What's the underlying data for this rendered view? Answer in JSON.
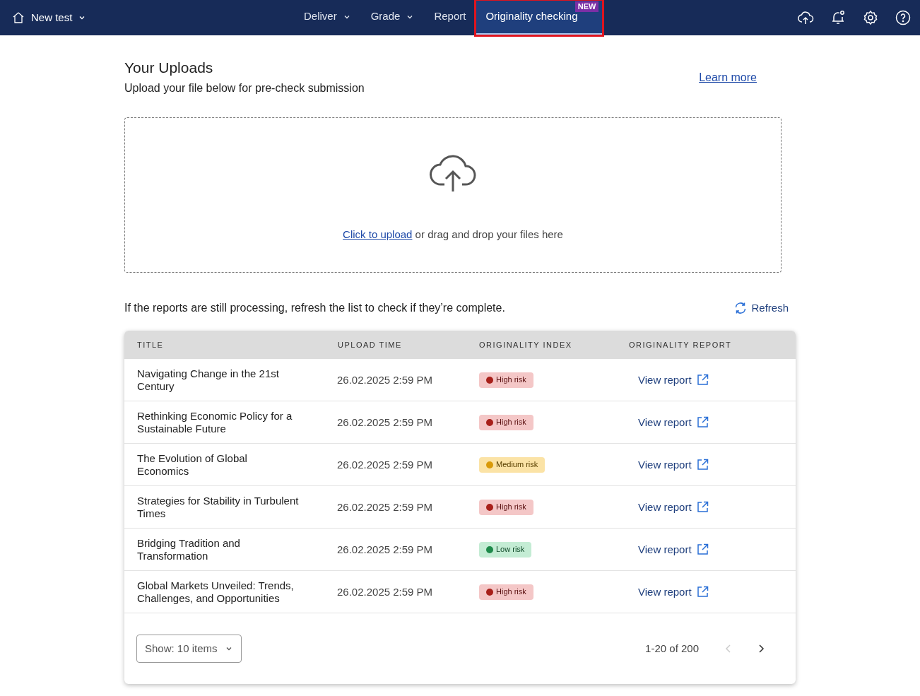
{
  "topbar": {
    "course": "New test",
    "nav": [
      {
        "label": "Deliver",
        "dropdown": true,
        "selected": false,
        "highlighted": false
      },
      {
        "label": "Grade",
        "dropdown": true,
        "selected": false,
        "highlighted": false
      },
      {
        "label": "Report",
        "dropdown": false,
        "selected": false,
        "highlighted": false
      },
      {
        "label": "Originality checking",
        "dropdown": false,
        "selected": true,
        "highlighted": true,
        "badge": "NEW"
      }
    ],
    "notification_dot": true
  },
  "uploads": {
    "title": "Your Uploads",
    "subtitle": "Upload your file below for pre-check submission",
    "learn_more": "Learn more",
    "upload_link": "Click to upload",
    "upload_text": "or drag and drop your files here"
  },
  "refresh": {
    "message": "If the reports are still processing, refresh the list to check if they’re complete.",
    "button": "Refresh"
  },
  "table": {
    "columns": [
      "TITLE",
      "UPLOAD TIME",
      "ORIGINALITY INDEX",
      "ORIGINALITY REPORT"
    ],
    "rows": [
      {
        "title": "Navigating Change in the 21st Century",
        "time": "26.02.2025 2:59 PM",
        "color": "#a8201a",
        "risk_label": "High risk",
        "report": "View report"
      },
      {
        "title": "Rethinking Economic Policy for a Sustainable Future",
        "time": "26.02.2025 2:59 PM",
        "color": "#a8201a",
        "risk_label": "High risk",
        "report": "View report"
      },
      {
        "title": "The Evolution of Global Economics",
        "time": "26.02.2025 2:59 PM",
        "color": "#d99a0a",
        "risk_label": "Medium risk",
        "report": "View report"
      },
      {
        "title": "Strategies for Stability in Turbulent Times",
        "time": "26.02.2025 2:59 PM",
        "color": "#a8201a",
        "risk_label": "High risk",
        "report": "View report"
      },
      {
        "title": "Bridging Tradition and Transformation",
        "time": "26.02.2025 2:59 PM",
        "color": "#1e8a4a",
        "risk_label": "Low risk",
        "report": "View report"
      },
      {
        "title": "Global Markets Unveiled: Trends, Challenges, and Opportunities",
        "time": "26.02.2025 2:59 PM",
        "color": "#a8201a",
        "risk_label": "High risk",
        "report": "View report"
      }
    ],
    "page_size": "Show: 10 items",
    "range": "1-20 of 200",
    "prev_disabled": true,
    "next_disabled": false
  }
}
